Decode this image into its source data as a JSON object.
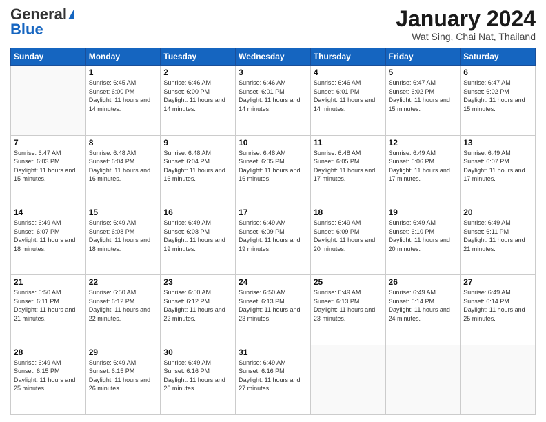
{
  "header": {
    "logo_general": "General",
    "logo_blue": "Blue",
    "month_title": "January 2024",
    "location": "Wat Sing, Chai Nat, Thailand"
  },
  "days_of_week": [
    "Sunday",
    "Monday",
    "Tuesday",
    "Wednesday",
    "Thursday",
    "Friday",
    "Saturday"
  ],
  "weeks": [
    [
      {
        "day": null,
        "sunrise": null,
        "sunset": null,
        "daylight": null
      },
      {
        "day": "1",
        "sunrise": "6:45 AM",
        "sunset": "6:00 PM",
        "daylight": "11 hours and 14 minutes."
      },
      {
        "day": "2",
        "sunrise": "6:46 AM",
        "sunset": "6:00 PM",
        "daylight": "11 hours and 14 minutes."
      },
      {
        "day": "3",
        "sunrise": "6:46 AM",
        "sunset": "6:01 PM",
        "daylight": "11 hours and 14 minutes."
      },
      {
        "day": "4",
        "sunrise": "6:46 AM",
        "sunset": "6:01 PM",
        "daylight": "11 hours and 14 minutes."
      },
      {
        "day": "5",
        "sunrise": "6:47 AM",
        "sunset": "6:02 PM",
        "daylight": "11 hours and 15 minutes."
      },
      {
        "day": "6",
        "sunrise": "6:47 AM",
        "sunset": "6:02 PM",
        "daylight": "11 hours and 15 minutes."
      }
    ],
    [
      {
        "day": "7",
        "sunrise": "6:47 AM",
        "sunset": "6:03 PM",
        "daylight": "11 hours and 15 minutes."
      },
      {
        "day": "8",
        "sunrise": "6:48 AM",
        "sunset": "6:04 PM",
        "daylight": "11 hours and 16 minutes."
      },
      {
        "day": "9",
        "sunrise": "6:48 AM",
        "sunset": "6:04 PM",
        "daylight": "11 hours and 16 minutes."
      },
      {
        "day": "10",
        "sunrise": "6:48 AM",
        "sunset": "6:05 PM",
        "daylight": "11 hours and 16 minutes."
      },
      {
        "day": "11",
        "sunrise": "6:48 AM",
        "sunset": "6:05 PM",
        "daylight": "11 hours and 17 minutes."
      },
      {
        "day": "12",
        "sunrise": "6:49 AM",
        "sunset": "6:06 PM",
        "daylight": "11 hours and 17 minutes."
      },
      {
        "day": "13",
        "sunrise": "6:49 AM",
        "sunset": "6:07 PM",
        "daylight": "11 hours and 17 minutes."
      }
    ],
    [
      {
        "day": "14",
        "sunrise": "6:49 AM",
        "sunset": "6:07 PM",
        "daylight": "11 hours and 18 minutes."
      },
      {
        "day": "15",
        "sunrise": "6:49 AM",
        "sunset": "6:08 PM",
        "daylight": "11 hours and 18 minutes."
      },
      {
        "day": "16",
        "sunrise": "6:49 AM",
        "sunset": "6:08 PM",
        "daylight": "11 hours and 19 minutes."
      },
      {
        "day": "17",
        "sunrise": "6:49 AM",
        "sunset": "6:09 PM",
        "daylight": "11 hours and 19 minutes."
      },
      {
        "day": "18",
        "sunrise": "6:49 AM",
        "sunset": "6:09 PM",
        "daylight": "11 hours and 20 minutes."
      },
      {
        "day": "19",
        "sunrise": "6:49 AM",
        "sunset": "6:10 PM",
        "daylight": "11 hours and 20 minutes."
      },
      {
        "day": "20",
        "sunrise": "6:49 AM",
        "sunset": "6:11 PM",
        "daylight": "11 hours and 21 minutes."
      }
    ],
    [
      {
        "day": "21",
        "sunrise": "6:50 AM",
        "sunset": "6:11 PM",
        "daylight": "11 hours and 21 minutes."
      },
      {
        "day": "22",
        "sunrise": "6:50 AM",
        "sunset": "6:12 PM",
        "daylight": "11 hours and 22 minutes."
      },
      {
        "day": "23",
        "sunrise": "6:50 AM",
        "sunset": "6:12 PM",
        "daylight": "11 hours and 22 minutes."
      },
      {
        "day": "24",
        "sunrise": "6:50 AM",
        "sunset": "6:13 PM",
        "daylight": "11 hours and 23 minutes."
      },
      {
        "day": "25",
        "sunrise": "6:49 AM",
        "sunset": "6:13 PM",
        "daylight": "11 hours and 23 minutes."
      },
      {
        "day": "26",
        "sunrise": "6:49 AM",
        "sunset": "6:14 PM",
        "daylight": "11 hours and 24 minutes."
      },
      {
        "day": "27",
        "sunrise": "6:49 AM",
        "sunset": "6:14 PM",
        "daylight": "11 hours and 25 minutes."
      }
    ],
    [
      {
        "day": "28",
        "sunrise": "6:49 AM",
        "sunset": "6:15 PM",
        "daylight": "11 hours and 25 minutes."
      },
      {
        "day": "29",
        "sunrise": "6:49 AM",
        "sunset": "6:15 PM",
        "daylight": "11 hours and 26 minutes."
      },
      {
        "day": "30",
        "sunrise": "6:49 AM",
        "sunset": "6:16 PM",
        "daylight": "11 hours and 26 minutes."
      },
      {
        "day": "31",
        "sunrise": "6:49 AM",
        "sunset": "6:16 PM",
        "daylight": "11 hours and 27 minutes."
      },
      {
        "day": null,
        "sunrise": null,
        "sunset": null,
        "daylight": null
      },
      {
        "day": null,
        "sunrise": null,
        "sunset": null,
        "daylight": null
      },
      {
        "day": null,
        "sunrise": null,
        "sunset": null,
        "daylight": null
      }
    ]
  ]
}
